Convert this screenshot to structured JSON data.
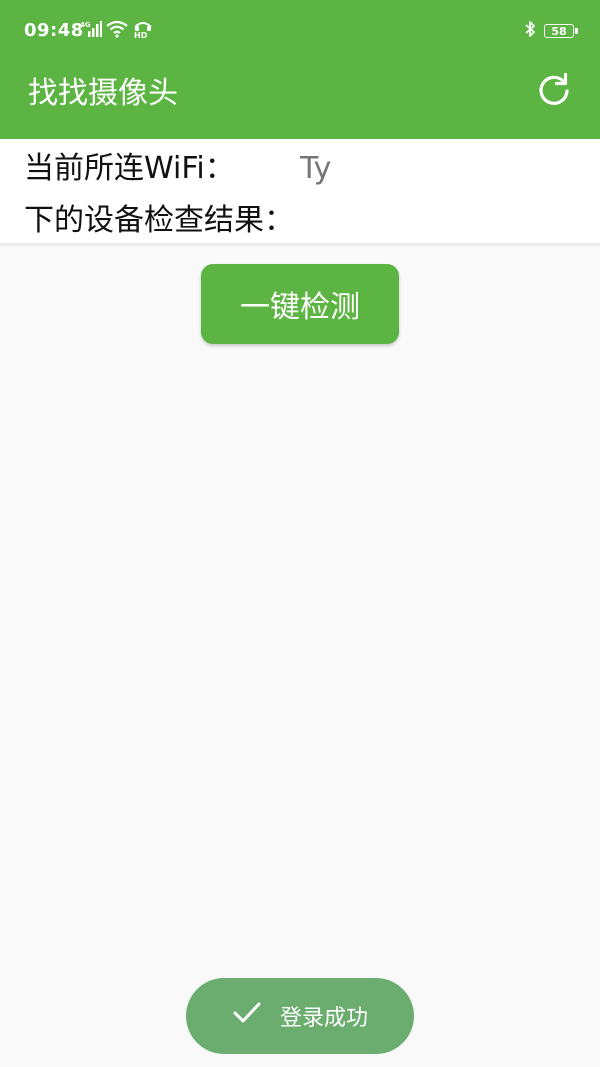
{
  "status_bar": {
    "time": "09:48",
    "network_label": "4G",
    "hd_label": "HD",
    "battery": "58"
  },
  "app_bar": {
    "title": "找找摄像头",
    "refresh_icon": "refresh-icon"
  },
  "info": {
    "wifi_label": "当前所连WiFi：",
    "wifi_value": "Ty",
    "result_label": "下的设备检查结果："
  },
  "actions": {
    "check_label": "一键检测"
  },
  "toast": {
    "icon": "check-icon",
    "message": "登录成功"
  },
  "colors": {
    "primary": "#5cb542",
    "toast_bg": "#6aad6e",
    "background": "#f9f9f9"
  }
}
